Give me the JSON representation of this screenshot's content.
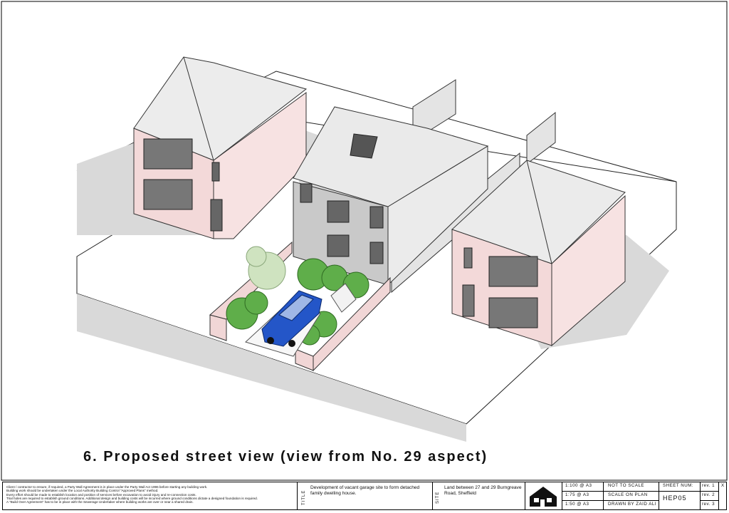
{
  "caption": "6. Proposed street view (view from No. 29 aspect)",
  "title_block": {
    "notes": [
      "Client / contractor to ensure, if required, a Party Wall Agreement is in place under the Party Wall Act 1996 before starting any building work.",
      "Building work should be undertaken under the Local Authority Building Control \"Approved Plans\" method.",
      "Every effort should be made to establish location and position of services before excavation to avoid injury and re-connection costs.",
      "Trial holes are required to establish ground conditions. Additional design and building costs will be incurred where ground conditions dictate a designed foundation is required.",
      "A \"Build Over Agreement\" has to be in place with the Sewerage Undertaker where building works are over or near a shared drain."
    ],
    "title_label": "TITLE",
    "title_text": "Development of vacant garage site to form detached family dwelling house.",
    "site_label": "SITE",
    "site_text": "Land between 27 and 29 Burngreave Road, Sheffield",
    "scales": [
      "1:100 @ A3",
      "1:75 @ A3",
      "1:50 @ A3"
    ],
    "scale_notes": [
      "NOT TO SCALE",
      "SCALE ON PLAN",
      "DRAWN BY ZAID ALI"
    ],
    "sheet_num_label": "SHEET NUM:",
    "sheet_num": "HEP05",
    "revs": [
      "rev. 1",
      "rev. 2",
      "rev. 3"
    ],
    "rev_mark": "X"
  },
  "colors": {
    "pink_wall": "#f3d9d9",
    "roof": "#e9e9e9",
    "grey_wall": "#cfcfcf",
    "car": "#2456c8",
    "shrub": "#5fae4a"
  }
}
